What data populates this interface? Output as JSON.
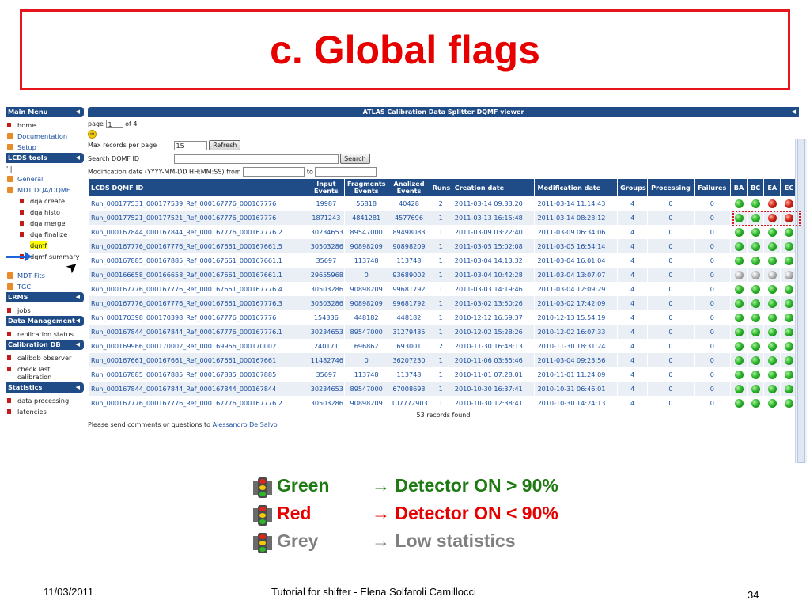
{
  "slide_title": "c. Global flags",
  "menu": {
    "sections": [
      {
        "header": "Main Menu",
        "items": [
          {
            "label": "home",
            "bullet": "red",
            "sub": false
          },
          {
            "label": "Documentation",
            "bullet": "orange",
            "sub": false,
            "blue": true
          },
          {
            "label": "Setup",
            "bullet": "orange",
            "sub": false,
            "blue": true
          }
        ]
      },
      {
        "header": "LCDS tools",
        "extra": "' |",
        "items": [
          {
            "label": "General",
            "bullet": "orange",
            "sub": false,
            "blue": true
          },
          {
            "label": "MDT DQA/DQMF",
            "bullet": "orange",
            "sub": false,
            "blue": true
          },
          {
            "label": "dqa create",
            "bullet": "red",
            "sub": true
          },
          {
            "label": "dqa histo",
            "bullet": "red",
            "sub": true
          },
          {
            "label": "dqa merge",
            "bullet": "red",
            "sub": true
          },
          {
            "label": "dqa finalize",
            "bullet": "red",
            "sub": true
          },
          {
            "label": "dqmf",
            "bullet": "none",
            "sub": true,
            "highlight": true
          },
          {
            "label": "dqmf summary",
            "bullet": "red",
            "sub": true,
            "tall": true
          },
          {
            "label": "MDT Fits",
            "bullet": "orange",
            "sub": false,
            "blue": true
          },
          {
            "label": "TGC",
            "bullet": "orange",
            "sub": false,
            "blue": true
          }
        ]
      },
      {
        "header": "LRMS",
        "items": [
          {
            "label": "jobs",
            "bullet": "red",
            "sub": false
          }
        ]
      },
      {
        "header": "Data Management",
        "items": [
          {
            "label": "replication status",
            "bullet": "red",
            "sub": false
          }
        ]
      },
      {
        "header": "Calibration DB",
        "items": [
          {
            "label": "calibdb observer",
            "bullet": "red",
            "sub": false
          },
          {
            "label": "check last calibration",
            "bullet": "red",
            "sub": false,
            "tall": true
          }
        ]
      },
      {
        "header": "Statistics",
        "items": [
          {
            "label": "data processing",
            "bullet": "red",
            "sub": false
          },
          {
            "label": "latencies",
            "bullet": "red",
            "sub": false
          }
        ]
      }
    ]
  },
  "viewer": {
    "title": "ATLAS Calibration Data Splitter DQMF viewer",
    "page_label": "page",
    "page_value": "1",
    "page_of": "of 4",
    "max_records_label": "Max records per page",
    "max_records_value": "15",
    "refresh_label": "Refresh",
    "search_label": "Search DQMF ID",
    "search_value": "",
    "search_button": "Search",
    "mod_label": "Modification date (YYYY-MM-DD HH:MM:SS) from",
    "mod_to": "to",
    "columns": [
      "LCDS DQMF ID",
      "Input Events",
      "Fragments Events",
      "Analized Events",
      "Runs",
      "Creation date",
      "Modification date",
      "Groups",
      "Processing",
      "Failures",
      "BA",
      "BC",
      "EA",
      "EC"
    ],
    "rows": [
      {
        "id": "Run_000177531_000177539_Ref_000167776_000167776",
        "input": "19987",
        "frag": "56818",
        "anal": "40428",
        "runs": "2",
        "created": "2011-03-14 09:33:20",
        "modified": "2011-03-14 11:14:43",
        "groups": "4",
        "proc": "0",
        "fail": "0",
        "flags": [
          "green",
          "green",
          "red",
          "red"
        ]
      },
      {
        "id": "Run_000177521_000177521_Ref_000167776_000167776",
        "input": "1871243",
        "frag": "4841281",
        "anal": "4577696",
        "runs": "1",
        "created": "2011-03-13 16:15:48",
        "modified": "2011-03-14 08:23:12",
        "groups": "4",
        "proc": "0",
        "fail": "0",
        "flags": [
          "green",
          "green",
          "red",
          "red"
        ]
      },
      {
        "id": "Run_000167844_000167844_Ref_000167776_000167776.2",
        "input": "30234653",
        "frag": "89547000",
        "anal": "89498083",
        "runs": "1",
        "created": "2011-03-09 03:22:40",
        "modified": "2011-03-09 06:34:06",
        "groups": "4",
        "proc": "0",
        "fail": "0",
        "flags": [
          "green",
          "green",
          "green",
          "green"
        ]
      },
      {
        "id": "Run_000167776_000167776_Ref_000167661_000167661.5",
        "input": "30503286",
        "frag": "90898209",
        "anal": "90898209",
        "runs": "1",
        "created": "2011-03-05 15:02:08",
        "modified": "2011-03-05 16:54:14",
        "groups": "4",
        "proc": "0",
        "fail": "0",
        "flags": [
          "green",
          "green",
          "green",
          "green"
        ]
      },
      {
        "id": "Run_000167885_000167885_Ref_000167661_000167661.1",
        "input": "35697",
        "frag": "113748",
        "anal": "113748",
        "runs": "1",
        "created": "2011-03-04 14:13:32",
        "modified": "2011-03-04 16:01:04",
        "groups": "4",
        "proc": "0",
        "fail": "0",
        "flags": [
          "green",
          "green",
          "green",
          "green"
        ]
      },
      {
        "id": "Run_000166658_000166658_Ref_000167661_000167661.1",
        "input": "29655968",
        "frag": "0",
        "anal": "93689002",
        "runs": "1",
        "created": "2011-03-04 10:42:28",
        "modified": "2011-03-04 13:07:07",
        "groups": "4",
        "proc": "0",
        "fail": "0",
        "flags": [
          "grey",
          "grey",
          "grey",
          "grey"
        ]
      },
      {
        "id": "Run_000167776_000167776_Ref_000167661_000167776.4",
        "input": "30503286",
        "frag": "90898209",
        "anal": "99681792",
        "runs": "1",
        "created": "2011-03-03 14:19:46",
        "modified": "2011-03-04 12:09:29",
        "groups": "4",
        "proc": "0",
        "fail": "0",
        "flags": [
          "green",
          "green",
          "green",
          "green"
        ]
      },
      {
        "id": "Run_000167776_000167776_Ref_000167661_000167776.3",
        "input": "30503286",
        "frag": "90898209",
        "anal": "99681792",
        "runs": "1",
        "created": "2011-03-02 13:50:26",
        "modified": "2011-03-02 17:42:09",
        "groups": "4",
        "proc": "0",
        "fail": "0",
        "flags": [
          "green",
          "green",
          "green",
          "green"
        ]
      },
      {
        "id": "Run_000170398_000170398_Ref_000167776_000167776",
        "input": "154336",
        "frag": "448182",
        "anal": "448182",
        "runs": "1",
        "created": "2010-12-12 16:59:37",
        "modified": "2010-12-13 15:54:19",
        "groups": "4",
        "proc": "0",
        "fail": "0",
        "flags": [
          "green",
          "green",
          "green",
          "green"
        ]
      },
      {
        "id": "Run_000167844_000167844_Ref_000167776_000167776.1",
        "input": "30234653",
        "frag": "89547000",
        "anal": "31279435",
        "runs": "1",
        "created": "2010-12-02 15:28:26",
        "modified": "2010-12-02 16:07:33",
        "groups": "4",
        "proc": "0",
        "fail": "0",
        "flags": [
          "green",
          "green",
          "green",
          "green"
        ]
      },
      {
        "id": "Run_000169966_000170002_Ref_000169966_000170002",
        "input": "240171",
        "frag": "696862",
        "anal": "693001",
        "runs": "2",
        "created": "2010-11-30 16:48:13",
        "modified": "2010-11-30 18:31:24",
        "groups": "4",
        "proc": "0",
        "fail": "0",
        "flags": [
          "green",
          "green",
          "green",
          "green"
        ]
      },
      {
        "id": "Run_000167661_000167661_Ref_000167661_000167661",
        "input": "11482746",
        "frag": "0",
        "anal": "36207230",
        "runs": "1",
        "created": "2010-11-06 03:35:46",
        "modified": "2011-03-04 09:23:56",
        "groups": "4",
        "proc": "0",
        "fail": "0",
        "flags": [
          "green",
          "green",
          "green",
          "green"
        ]
      },
      {
        "id": "Run_000167885_000167885_Ref_000167885_000167885",
        "input": "35697",
        "frag": "113748",
        "anal": "113748",
        "runs": "1",
        "created": "2010-11-01 07:28:01",
        "modified": "2010-11-01 11:24:09",
        "groups": "4",
        "proc": "0",
        "fail": "0",
        "flags": [
          "green",
          "green",
          "green",
          "green"
        ]
      },
      {
        "id": "Run_000167844_000167844_Ref_000167844_000167844",
        "input": "30234653",
        "frag": "89547000",
        "anal": "67008693",
        "runs": "1",
        "created": "2010-10-30 16:37:41",
        "modified": "2010-10-31 06:46:01",
        "groups": "4",
        "proc": "0",
        "fail": "0",
        "flags": [
          "green",
          "green",
          "green",
          "green"
        ]
      },
      {
        "id": "Run_000167776_000167776_Ref_000167776_000167776.2",
        "input": "30503286",
        "frag": "90898209",
        "anal": "107772903",
        "runs": "1",
        "created": "2010-10-30 12:38:41",
        "modified": "2010-10-30 14:24:13",
        "groups": "4",
        "proc": "0",
        "fail": "0",
        "flags": [
          "green",
          "green",
          "green",
          "green"
        ]
      }
    ],
    "records_found": "53 records found",
    "comments_text": "Please send comments or questions to",
    "comments_link": "Alessandro De Salvo"
  },
  "legend": [
    {
      "name": "Green",
      "desc": "Detector ON > 90%",
      "color_class": "c-green",
      "light": "green"
    },
    {
      "name": "Red",
      "desc": "Detector ON < 90%",
      "color_class": "c-red",
      "light": "red"
    },
    {
      "name": "Grey",
      "desc": "Low statistics",
      "color_class": "c-grey",
      "light": "grey"
    }
  ],
  "legend_arrow": "→",
  "footer": {
    "date": "11/03/2011",
    "center": "Tutorial for shifter - Elena Solfaroli Camillocci",
    "page_number": "34"
  },
  "colors": {
    "title_red": "#e60000",
    "header_blue": "#1f4b87",
    "link_blue": "#1a4fa0",
    "green": "#1e7a12",
    "grey": "#808080"
  }
}
